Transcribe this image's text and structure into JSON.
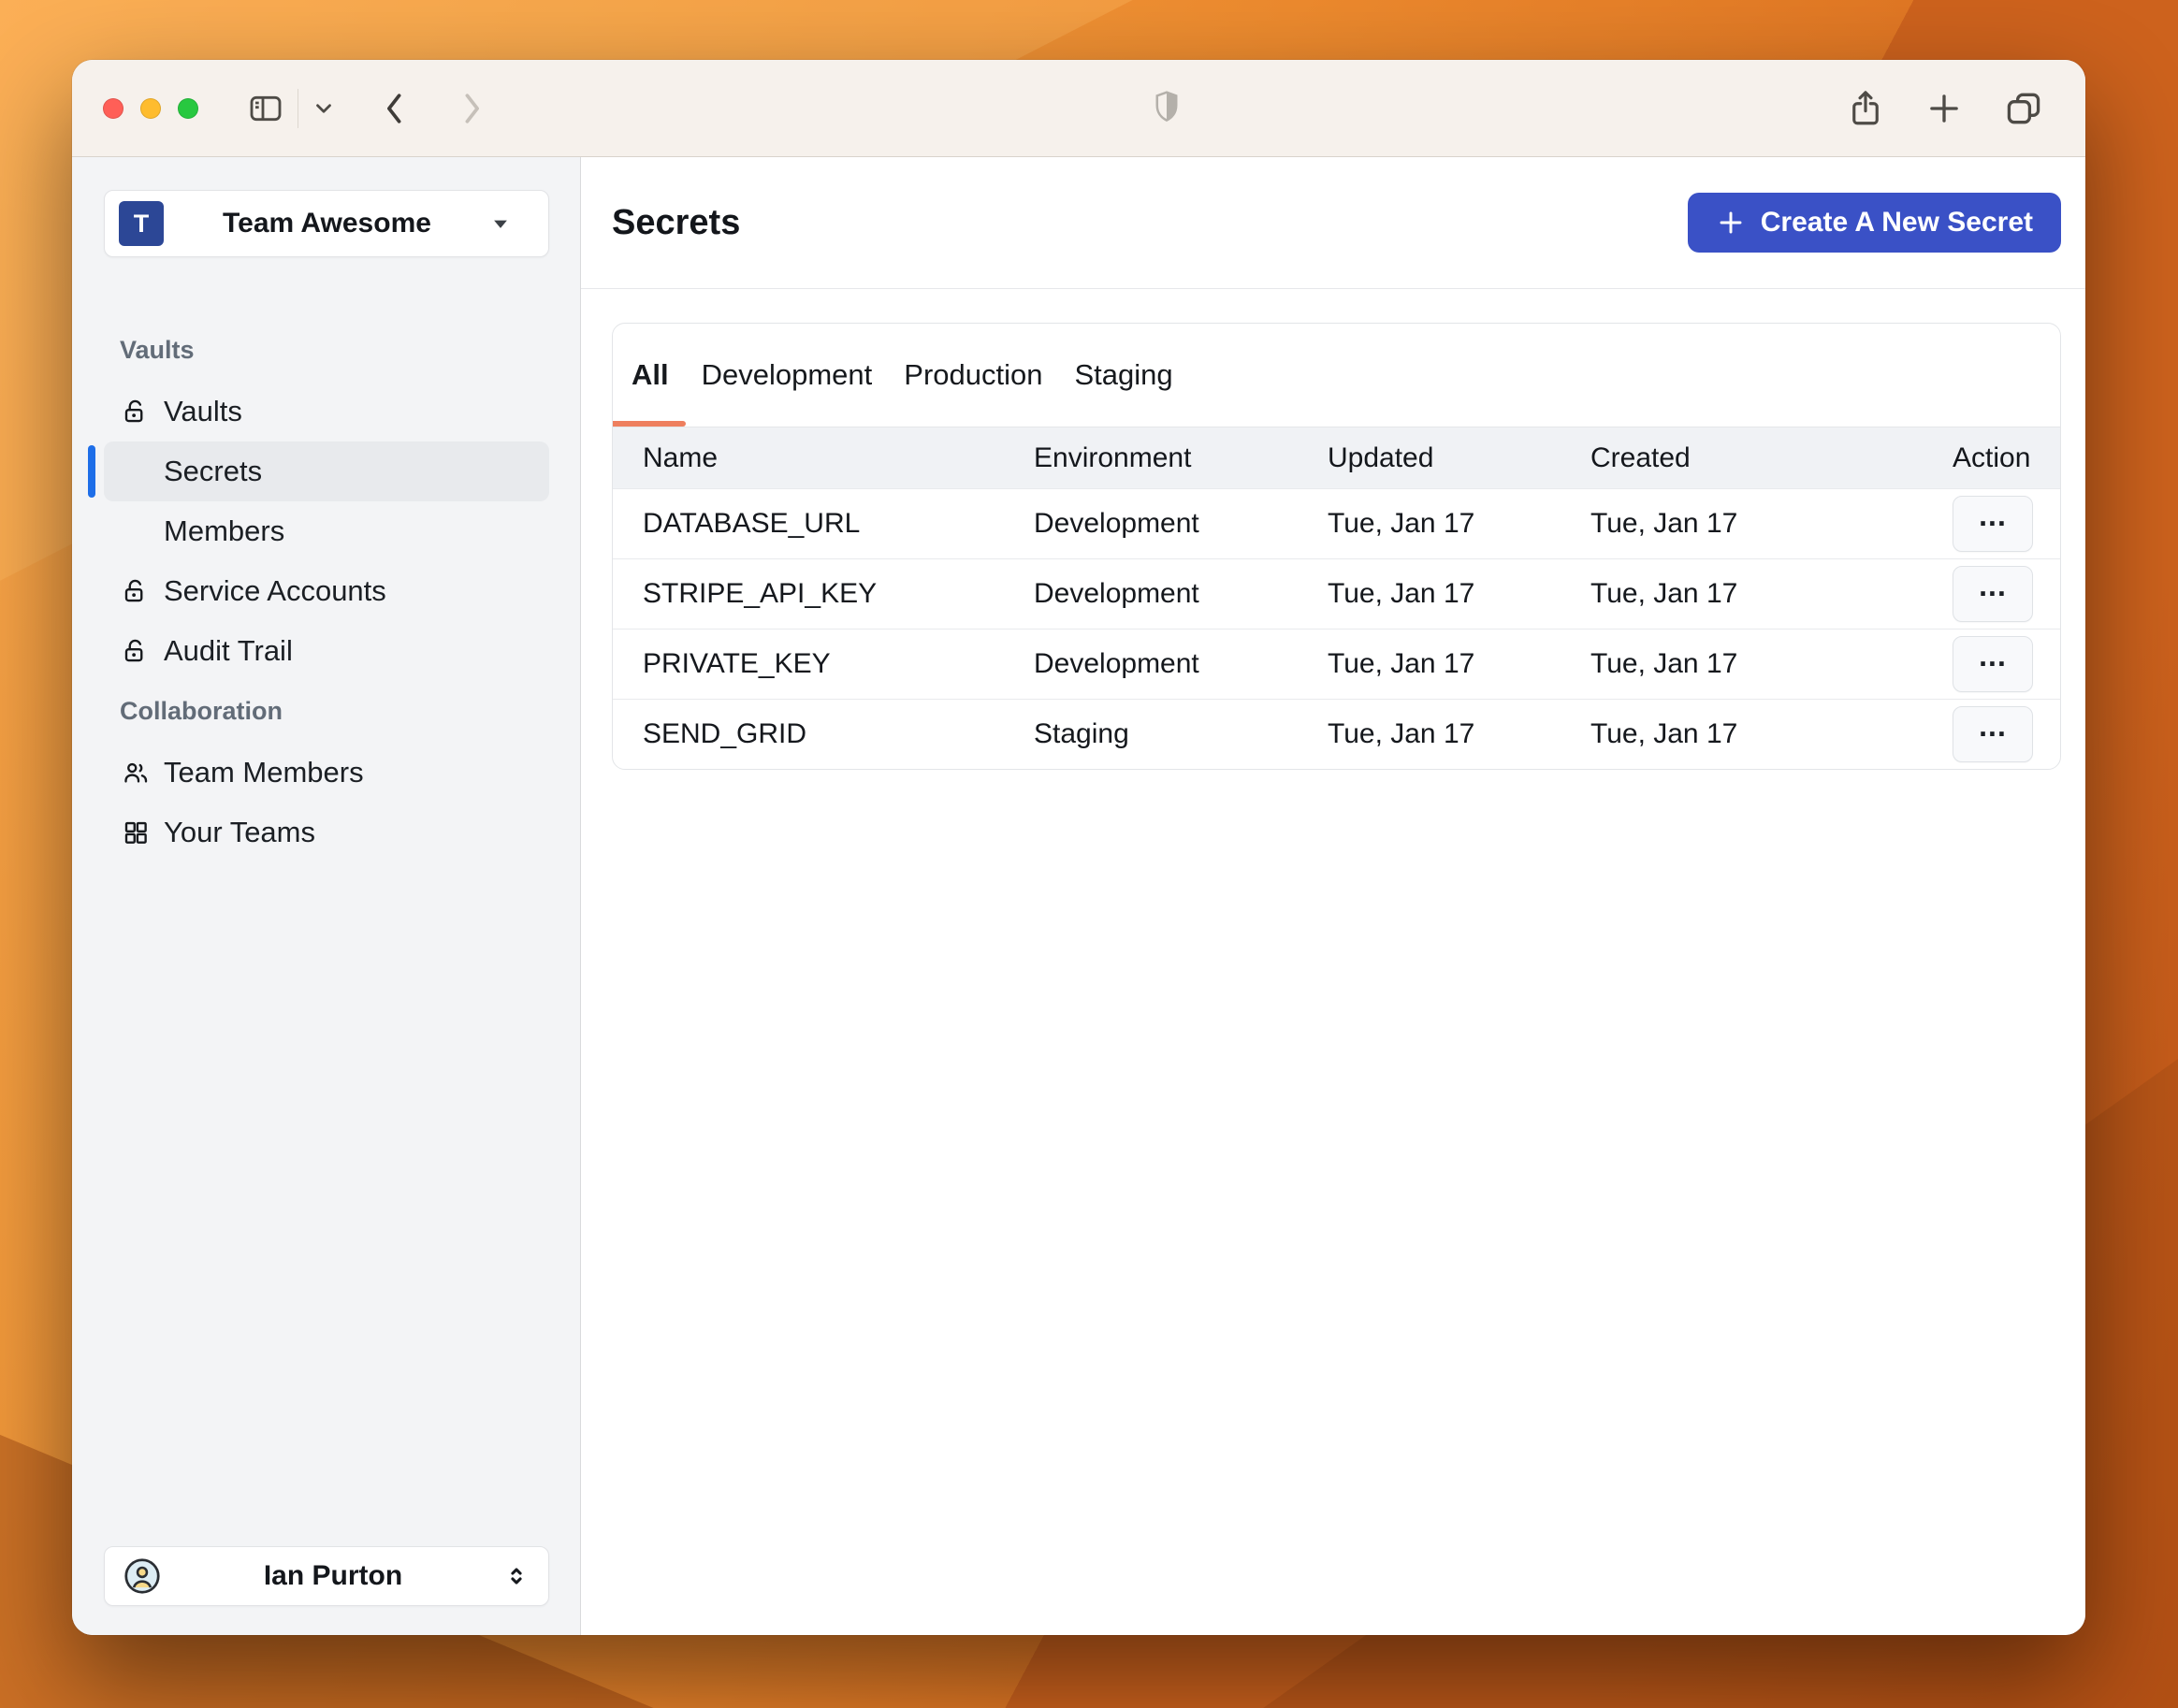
{
  "window": {
    "titlebar": {
      "traffic_lights": [
        "close",
        "minimize",
        "maximize"
      ],
      "icons": [
        "sidebar-toggle",
        "chevron-down",
        "back",
        "forward",
        "shield",
        "share",
        "new-tab",
        "tab-overview"
      ]
    }
  },
  "sidebar": {
    "team_selector": {
      "avatar_initial": "T",
      "name": "Team Awesome",
      "icon": "caret-down"
    },
    "sections": [
      {
        "label": "Vaults",
        "items": [
          {
            "label": "Vaults",
            "icon": "unlock",
            "selected": false
          },
          {
            "label": "Secrets",
            "icon": null,
            "selected": true
          },
          {
            "label": "Members",
            "icon": null,
            "selected": false
          },
          {
            "label": "Service Accounts",
            "icon": "unlock",
            "selected": false
          },
          {
            "label": "Audit Trail",
            "icon": "unlock",
            "selected": false
          }
        ]
      },
      {
        "label": "Collaboration",
        "items": [
          {
            "label": "Team Members",
            "icon": "people",
            "selected": false
          },
          {
            "label": "Your Teams",
            "icon": "grid",
            "selected": false
          }
        ]
      }
    ],
    "user_selector": {
      "name": "Ian Purton",
      "icon": "person-circle"
    }
  },
  "main": {
    "title": "Secrets",
    "create_button": {
      "icon": "plus",
      "label": "Create A New Secret"
    },
    "tabs": [
      {
        "label": "All",
        "active": true
      },
      {
        "label": "Development",
        "active": false
      },
      {
        "label": "Production",
        "active": false
      },
      {
        "label": "Staging",
        "active": false
      }
    ],
    "table": {
      "columns": [
        "Name",
        "Environment",
        "Updated",
        "Created",
        "Action"
      ],
      "action_label": "...",
      "rows": [
        {
          "name": "DATABASE_URL",
          "environment": "Development",
          "updated": "Tue, Jan 17",
          "created": "Tue, Jan 17"
        },
        {
          "name": "STRIPE_API_KEY",
          "environment": "Development",
          "updated": "Tue, Jan 17",
          "created": "Tue, Jan 17"
        },
        {
          "name": "PRIVATE_KEY",
          "environment": "Development",
          "updated": "Tue, Jan 17",
          "created": "Tue, Jan 17"
        },
        {
          "name": "SEND_GRID",
          "environment": "Staging",
          "updated": "Tue, Jan 17",
          "created": "Tue, Jan 17"
        }
      ]
    }
  },
  "colors": {
    "accent_blue": "#3a51c6",
    "team_avatar_blue": "#2c4796",
    "selected_indicator_blue": "#1e6ee8",
    "active_tab_underline": "#ee7f5e",
    "traffic_red": "#ff5f57",
    "traffic_yellow": "#febc2e",
    "traffic_green": "#28c840"
  }
}
